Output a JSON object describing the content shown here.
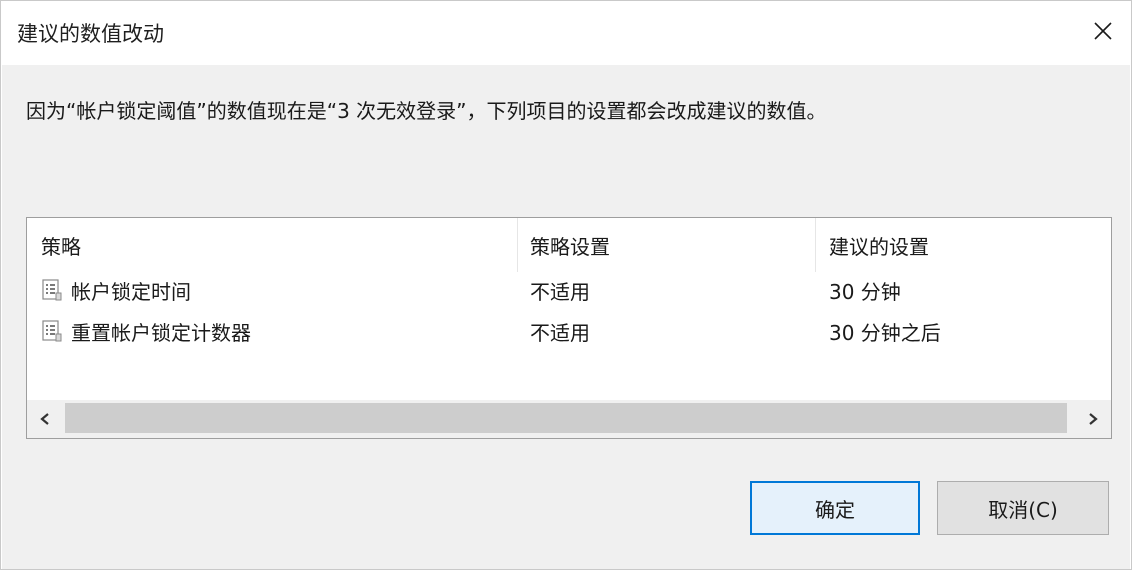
{
  "window": {
    "title": "建议的数值改动"
  },
  "message": "因为“帐户锁定阈值”的数值现在是“3 次无效登录”，下列项目的设置都会改成建议的数值。",
  "table": {
    "columns": [
      "策略",
      "策略设置",
      "建议的设置"
    ],
    "rows": [
      {
        "policy": "帐户锁定时间",
        "setting": "不适用",
        "suggested": "30 分钟"
      },
      {
        "policy": "重置帐户锁定计数器",
        "setting": "不适用",
        "suggested": "30 分钟之后"
      }
    ]
  },
  "buttons": {
    "ok": "确定",
    "cancel": "取消(C)"
  },
  "colors": {
    "accent": "#0078d7",
    "body_bg": "#f0f0f0"
  }
}
